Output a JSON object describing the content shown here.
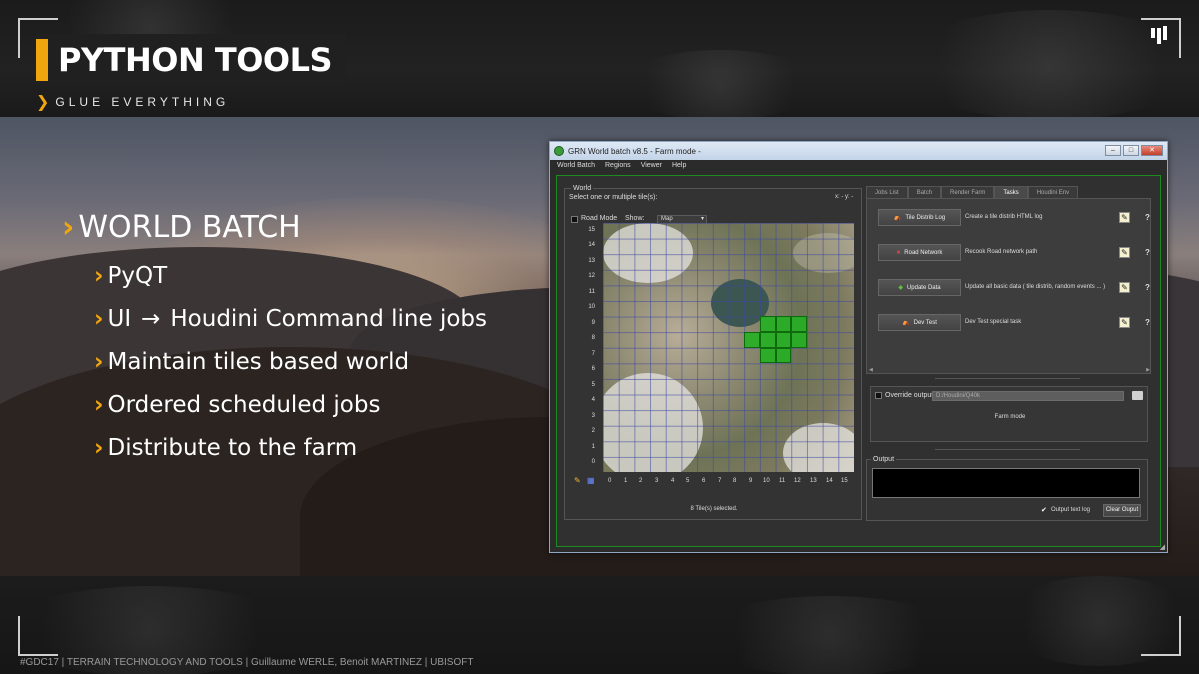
{
  "slide": {
    "title": "PYTHON TOOLS",
    "subtitle": "GLUE EVERYTHING",
    "footer": "#GDC17 | TERRAIN TECHNOLOGY AND TOOLS | Guillaume WERLE, Benoit MARTINEZ | UBISOFT",
    "accent_color": "#f2a60d"
  },
  "bullets": {
    "main": "WORLD BATCH",
    "items": [
      "PyQT",
      "UI",
      "Houdini Command line jobs",
      "Maintain tiles based world",
      "Ordered scheduled jobs",
      "Distribute to the farm"
    ],
    "arrow": "→"
  },
  "window": {
    "title": "GRN World batch v8.5 - Farm mode -",
    "buttons": [
      "–",
      "□",
      "✕"
    ],
    "menu": [
      "World Batch",
      "Regions",
      "Viewer",
      "Help"
    ]
  },
  "world": {
    "group_label": "World",
    "hint": "Select one or multiple tile(s):",
    "coords": "x: - y: -",
    "road_mode_label": "Road Mode",
    "show_label": "Show:",
    "show_value": "Map",
    "y_ticks": [
      "15",
      "14",
      "13",
      "12",
      "11",
      "10",
      "9",
      "8",
      "7",
      "6",
      "5",
      "4",
      "3",
      "2",
      "1",
      "0"
    ],
    "x_ticks": [
      "0",
      "1",
      "2",
      "3",
      "4",
      "5",
      "6",
      "7",
      "8",
      "9",
      "10",
      "11",
      "12",
      "13",
      "14",
      "15"
    ],
    "selected_tiles": [
      [
        10,
        9
      ],
      [
        11,
        9
      ],
      [
        12,
        9
      ],
      [
        9,
        8
      ],
      [
        10,
        8
      ],
      [
        11,
        8
      ],
      [
        12,
        8
      ],
      [
        10,
        7
      ],
      [
        11,
        7
      ]
    ],
    "tile_count": "8 Tile(s) selected."
  },
  "tabs": {
    "items": [
      "Jobs List",
      "Batch",
      "Render Farm",
      "Tasks",
      "Houdini Env"
    ],
    "active": "Tasks"
  },
  "tasks": [
    {
      "button": "Tile Distrib Log",
      "desc": "Create a tile distrib HTML log",
      "icon": "tent-icon"
    },
    {
      "button": "Road Network",
      "desc": "Recook Road network path",
      "icon": "car-icon"
    },
    {
      "button": "Update Data",
      "desc": "Update all basic data ( tile distrib, random events ... )",
      "icon": "cube-icon"
    },
    {
      "button": "Dev Test",
      "desc": "Dev Test special task",
      "icon": "tent-icon"
    }
  ],
  "task_help": "?",
  "task_scroll": {
    "left": "◀",
    "right": "▶"
  },
  "override": {
    "label": "Override output",
    "path": "D:/Houdini/Q40k",
    "mode": "Farm mode"
  },
  "output": {
    "label": "Output",
    "log_label": "Output text log",
    "clear_label": "Clear Ouput"
  }
}
